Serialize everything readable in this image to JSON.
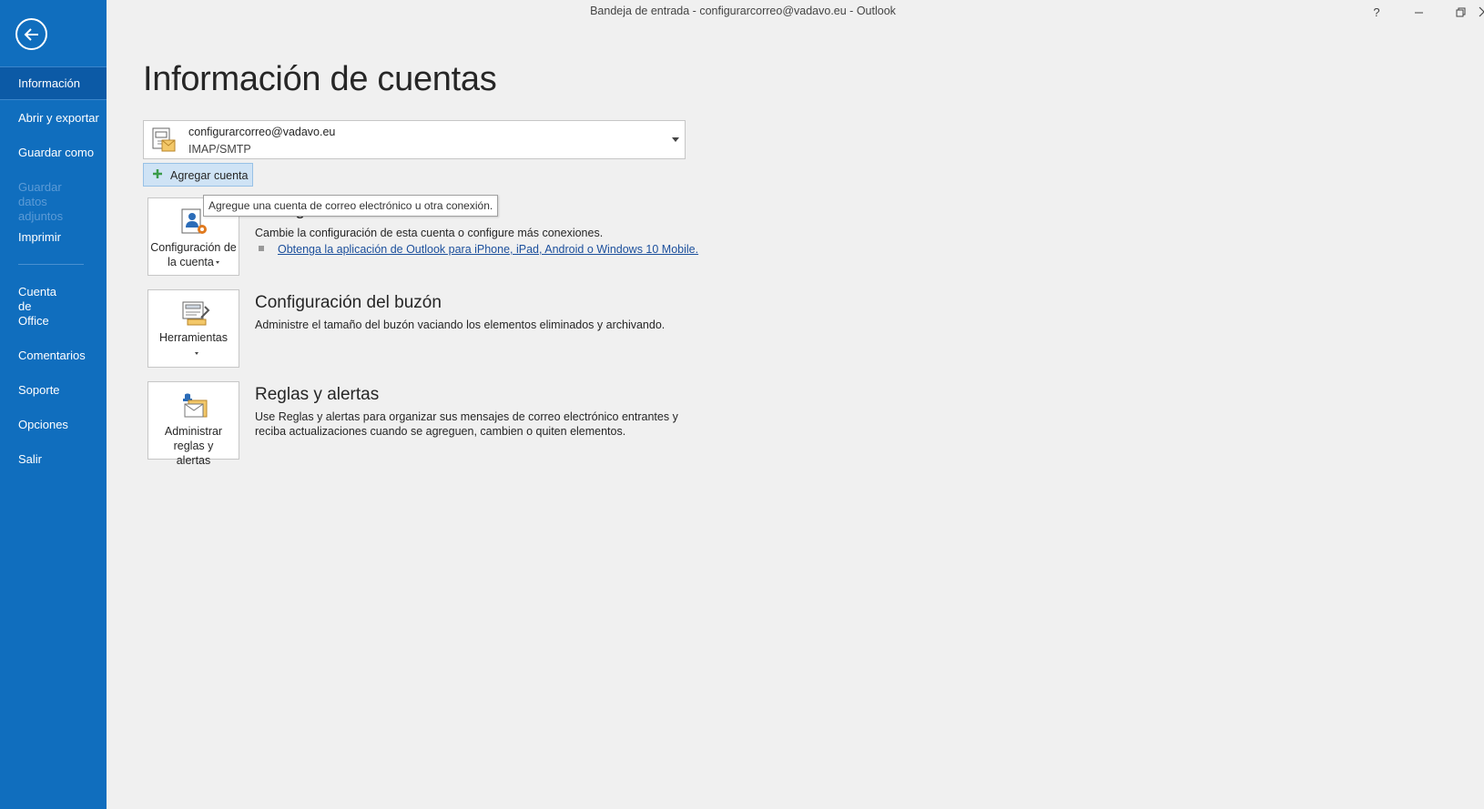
{
  "window": {
    "title": "Bandeja de entrada - configurarcorreo@vadavo.eu  -  Outlook",
    "help": "?"
  },
  "sidebar": {
    "items": [
      {
        "label": "Información"
      },
      {
        "label": "Abrir y exportar"
      },
      {
        "label": "Guardar como"
      },
      {
        "label": "Guardar datos adjuntos"
      },
      {
        "label": "Imprimir"
      },
      {
        "label": "Cuenta de Office"
      },
      {
        "label": "Comentarios"
      },
      {
        "label": "Soporte"
      },
      {
        "label": "Opciones"
      },
      {
        "label": "Salir"
      }
    ]
  },
  "main": {
    "title": "Información de cuentas",
    "account": {
      "email": "configurarcorreo@vadavo.eu",
      "type": "IMAP/SMTP"
    },
    "add_account_label": "Agregar cuenta",
    "tooltip": "Agregue una cuenta de correo electrónico u otra conexión.",
    "sections": [
      {
        "tile_label": "Configuración de la cuenta",
        "heading": "Configuración de la cuenta",
        "desc": "Cambie la configuración de esta cuenta o configure más conexiones.",
        "link": "Obtenga la aplicación de Outlook para iPhone, iPad, Android o Windows 10 Mobile."
      },
      {
        "tile_label": "Herramientas",
        "heading": "Configuración del buzón",
        "desc": "Administre el tamaño del buzón vaciando los elementos eliminados y archivando."
      },
      {
        "tile_label": "Administrar reglas y alertas",
        "heading": "Reglas y alertas",
        "desc": "Use Reglas y alertas para organizar sus mensajes de correo electrónico entrantes y reciba actualizaciones cuando se agreguen, cambien o quiten elementos."
      }
    ]
  },
  "colors": {
    "sidebar": "#106ebe",
    "sidebar_active": "#0c5aa6",
    "link": "#1b4f9c",
    "add_button": "#cfe3f5"
  },
  "icons": [
    "back-arrow-icon",
    "plus-icon",
    "account-settings-icon",
    "tools-icon",
    "rules-alerts-icon",
    "dropdown-arrow-icon"
  ]
}
